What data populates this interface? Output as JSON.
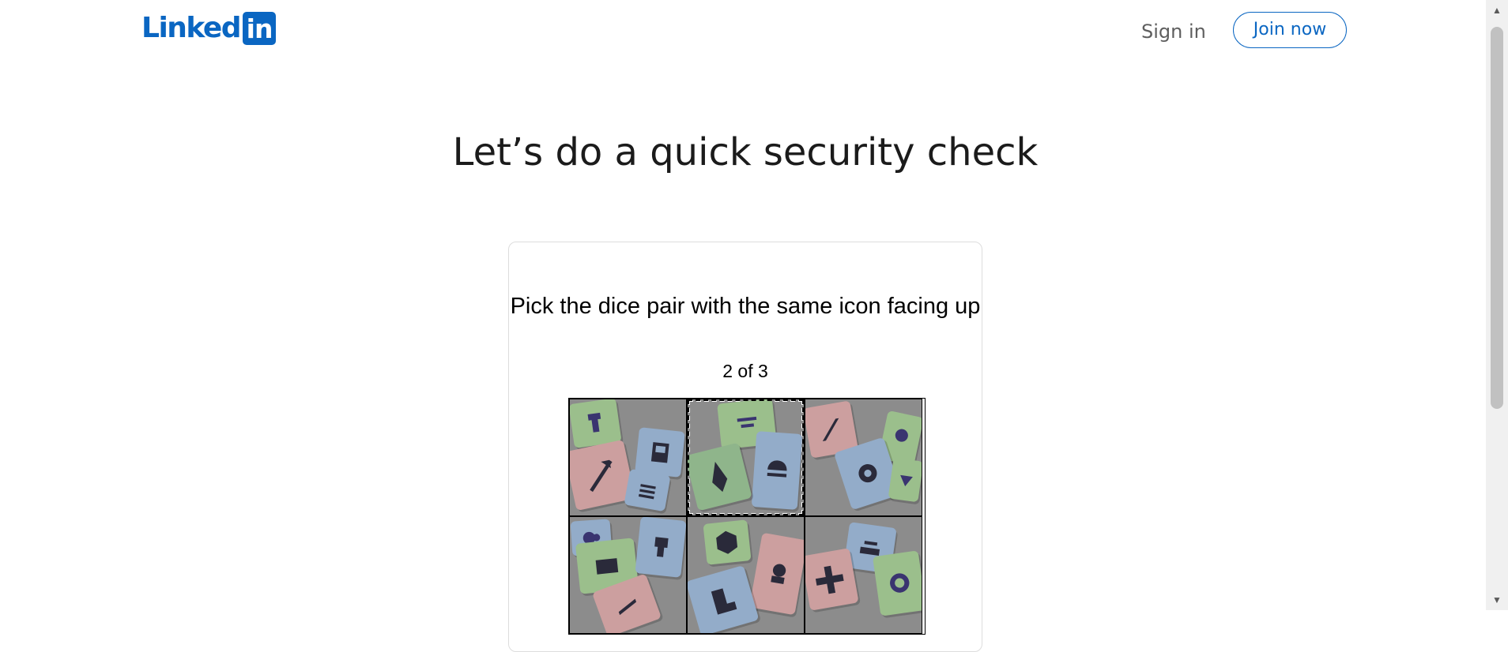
{
  "header": {
    "logo_text": "Linked",
    "logo_box_text": "in",
    "signin_label": "Sign in",
    "join_label": "Join now",
    "brand_color": "#0a66c2"
  },
  "main": {
    "title": "Let’s do a quick security check"
  },
  "challenge": {
    "prompt": "Pick the dice pair with the same icon facing up",
    "progress": "2 of 3",
    "tiles": [
      {
        "id": "tile-1",
        "focused": false
      },
      {
        "id": "tile-2",
        "focused": true
      },
      {
        "id": "tile-3",
        "focused": false
      },
      {
        "id": "tile-4",
        "focused": false
      },
      {
        "id": "tile-5",
        "focused": false
      },
      {
        "id": "tile-6",
        "focused": false
      }
    ]
  },
  "scrollbar": {
    "up_icon": "scroll-up-arrow-icon",
    "down_icon": "scroll-down-arrow-icon"
  }
}
